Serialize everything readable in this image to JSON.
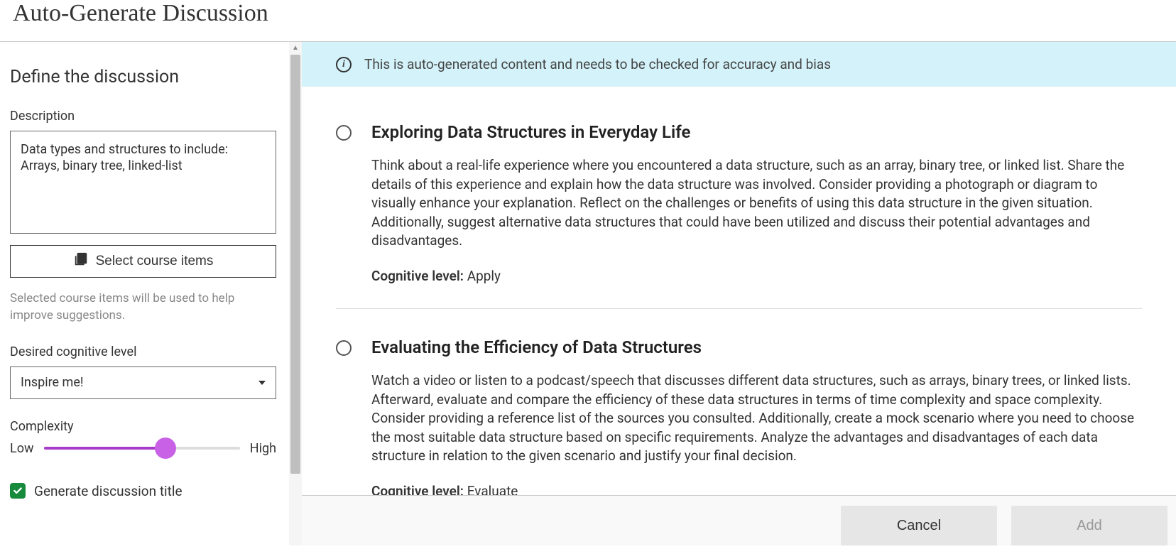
{
  "pageTitle": "Auto-Generate Discussion",
  "sidebar": {
    "heading": "Define the discussion",
    "description": {
      "label": "Description",
      "value": "Data types and structures to include: Arrays, binary tree, linked-list"
    },
    "selectItemsButton": "Select course items",
    "helperText": "Selected course items will be used to help improve suggestions.",
    "cognitiveLevel": {
      "label": "Desired cognitive level",
      "value": "Inspire me!"
    },
    "complexity": {
      "label": "Complexity",
      "lowLabel": "Low",
      "highLabel": "High",
      "percent": 62
    },
    "generateTitle": {
      "label": "Generate discussion title",
      "checked": true
    }
  },
  "notice": "This is auto-generated content and needs to be checked for accuracy and bias",
  "cognitiveLevelPrefix": "Cognitive level: ",
  "results": [
    {
      "title": "Exploring Data Structures in Everyday Life",
      "description": "Think about a real-life experience where you encountered a data structure, such as an array, binary tree, or linked list. Share the details of this experience and explain how the data structure was involved. Consider providing a photograph or diagram to visually enhance your explanation. Reflect on the challenges or benefits of using this data structure in the given situation. Additionally, suggest alternative data structures that could have been utilized and discuss their potential advantages and disadvantages.",
      "cognitiveLevel": "Apply"
    },
    {
      "title": "Evaluating the Efficiency of Data Structures",
      "description": "Watch a video or listen to a podcast/speech that discusses different data structures, such as arrays, binary trees, or linked lists. Afterward, evaluate and compare the efficiency of these data structures in terms of time complexity and space complexity. Consider providing a reference list of the sources you consulted. Additionally, create a mock scenario where you need to choose the most suitable data structure based on specific requirements. Analyze the advantages and disadvantages of each data structure in relation to the given scenario and justify your final decision.",
      "cognitiveLevel": "Evaluate"
    }
  ],
  "footer": {
    "cancel": "Cancel",
    "add": "Add"
  }
}
